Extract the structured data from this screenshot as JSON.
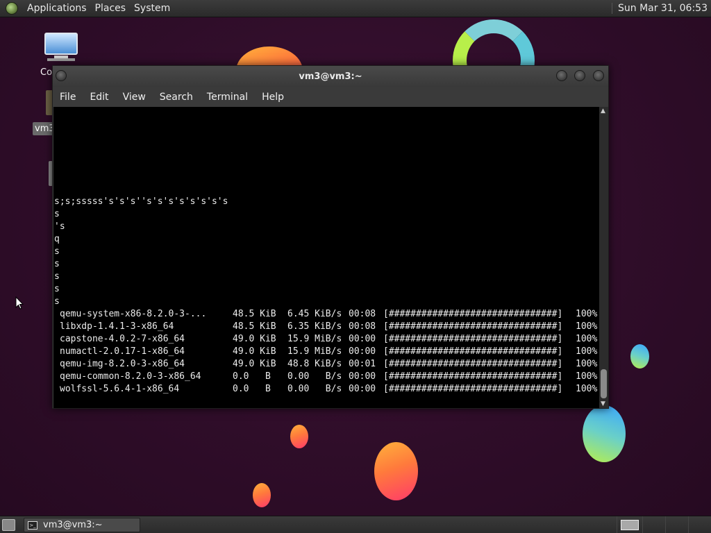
{
  "top_panel": {
    "menus": [
      "Applications",
      "Places",
      "System"
    ],
    "clock": "Sun Mar 31, 06:53"
  },
  "desktop": {
    "icons": [
      {
        "label": "Co"
      },
      {
        "label": "vm3"
      }
    ]
  },
  "terminal": {
    "title": "vm3@vm3:~",
    "menu": [
      "File",
      "Edit",
      "View",
      "Search",
      "Terminal",
      "Help"
    ],
    "lines": [
      "s;s;sssss's's's''s's's's's's's's",
      "s",
      "'s",
      "q",
      "s",
      "s",
      "s",
      "s",
      "s"
    ],
    "downloads": [
      {
        "name": "qemu-system-x86-8.2.0-3-...",
        "size": "48.5 KiB",
        "rate": "6.45 KiB/s",
        "time": "00:08",
        "bar": "[###############################]",
        "pct": "100%"
      },
      {
        "name": "libxdp-1.4.1-3-x86_64",
        "size": "48.5 KiB",
        "rate": "6.35 KiB/s",
        "time": "00:08",
        "bar": "[###############################]",
        "pct": "100%"
      },
      {
        "name": "capstone-4.0.2-7-x86_64",
        "size": "49.0 KiB",
        "rate": "15.9 MiB/s",
        "time": "00:00",
        "bar": "[###############################]",
        "pct": "100%"
      },
      {
        "name": "numactl-2.0.17-1-x86_64",
        "size": "49.0 KiB",
        "rate": "15.9 MiB/s",
        "time": "00:00",
        "bar": "[###############################]",
        "pct": "100%"
      },
      {
        "name": "qemu-img-8.2.0-3-x86_64",
        "size": "49.0 KiB",
        "rate": "48.8 KiB/s",
        "time": "00:01",
        "bar": "[###############################]",
        "pct": "100%"
      },
      {
        "name": "qemu-common-8.2.0-3-x86_64",
        "size": "0.0   B",
        "rate": "0.00   B/s",
        "time": "00:00",
        "bar": "[###############################]",
        "pct": "100%"
      },
      {
        "name": "wolfssl-5.6.4-1-x86_64",
        "size": "0.0   B",
        "rate": "0.00   B/s",
        "time": "00:00",
        "bar": "[###############################]",
        "pct": "100%"
      }
    ]
  },
  "taskbar": {
    "task_label": "vm3@vm3:~"
  }
}
